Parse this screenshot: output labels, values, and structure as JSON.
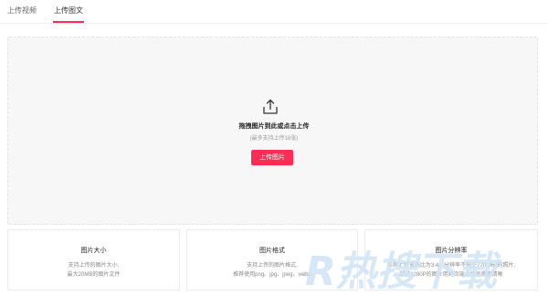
{
  "tabs": [
    {
      "label": "上传视频",
      "active": false
    },
    {
      "label": "上传图文",
      "active": true
    }
  ],
  "upload": {
    "title": "拖拽图片到此或点击上传",
    "hint": "(最多支持上传18张)",
    "button_label": "上传图片",
    "icon": "upload-icon"
  },
  "cards": [
    {
      "title": "图片大小",
      "lines": [
        "支持上传的图片大小,",
        "最大20MB的图片文件"
      ]
    },
    {
      "title": "图片格式",
      "lines": [
        "支持上传的图片格式,",
        "推荐使用png、jpg、jpeg、webp"
      ]
    },
    {
      "title": "图片分辨率",
      "lines": [
        "推荐上传宽高比为3:4，分辨率不低于720*960的照片,",
        "超过1280P的图片用网页端上传画质更清晰"
      ]
    }
  ],
  "watermark": {
    "text": "R热搜下载"
  },
  "colors": {
    "accent": "#fe2c55",
    "zone_bg": "#f7f7f8",
    "watermark": "#cfe3f7"
  }
}
